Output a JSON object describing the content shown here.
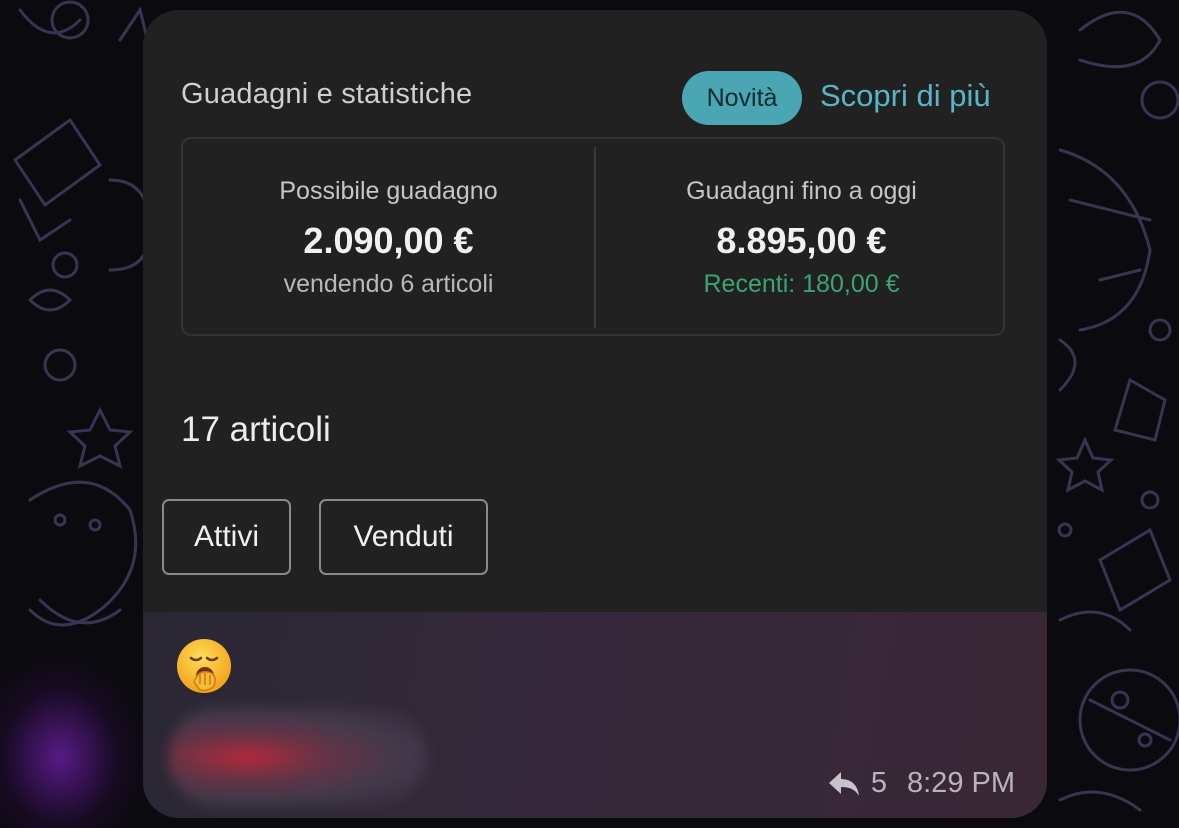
{
  "card": {
    "title": "Guadagni e statistiche",
    "badge": "Novità",
    "learn_more": "Scopri di più"
  },
  "stats": {
    "possible": {
      "label": "Possibile guadagno",
      "value": "2.090,00 €",
      "sub": "vendendo 6 articoli"
    },
    "earned": {
      "label": "Guadagni fino a oggi",
      "value": "8.895,00 €",
      "sub": "Recenti: 180,00 €"
    }
  },
  "items": {
    "count_label": "17 articoli",
    "filters": [
      "Attivi",
      "Venduti"
    ]
  },
  "message": {
    "reaction_emoji": "yawning-face-icon",
    "reply_count": "5",
    "time": "8:29 PM"
  },
  "colors": {
    "accent": "#56b6c6",
    "badge_bg": "#4aa6b2",
    "positive": "#3aa573",
    "card_bg": "#212121"
  }
}
